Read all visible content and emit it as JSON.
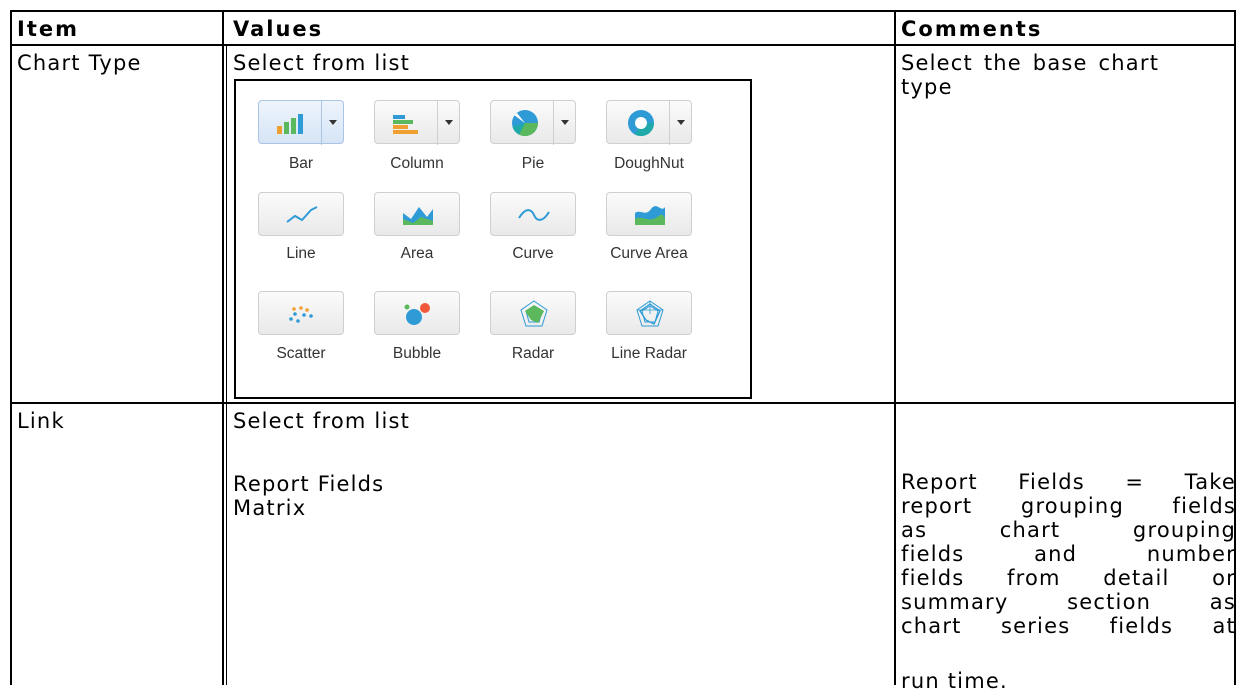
{
  "headers": {
    "item": "Item",
    "values": "Values",
    "comments": "Comments"
  },
  "rows": [
    {
      "item": "Chart Type",
      "value": "Select from list",
      "comment_line1": "Select the base chart",
      "comment_line2": "type"
    },
    {
      "item": "Link",
      "value": "Select from list",
      "options": [
        "Report Fields",
        "Matrix"
      ],
      "comment_lines": [
        "Report Fields = Take",
        "report grouping fields",
        "as chart grouping",
        "fields and number",
        "fields from detail or",
        "summary section as",
        "chart series fields at",
        "run time."
      ]
    }
  ],
  "chart_types": [
    {
      "label": "Bar",
      "icon": "bar-chart-icon",
      "dropdown": true,
      "selected": true
    },
    {
      "label": "Column",
      "icon": "column-chart-icon",
      "dropdown": true,
      "selected": false
    },
    {
      "label": "Pie",
      "icon": "pie-chart-icon",
      "dropdown": true,
      "selected": false
    },
    {
      "label": "DoughNut",
      "icon": "doughnut-chart-icon",
      "dropdown": true,
      "selected": false
    },
    {
      "label": "Line",
      "icon": "line-chart-icon",
      "dropdown": false,
      "selected": false
    },
    {
      "label": "Area",
      "icon": "area-chart-icon",
      "dropdown": false,
      "selected": false
    },
    {
      "label": "Curve",
      "icon": "curve-chart-icon",
      "dropdown": false,
      "selected": false
    },
    {
      "label": "Curve Area",
      "icon": "curve-area-chart-icon",
      "dropdown": false,
      "selected": false
    },
    {
      "label": "Scatter",
      "icon": "scatter-chart-icon",
      "dropdown": false,
      "selected": false
    },
    {
      "label": "Bubble",
      "icon": "bubble-chart-icon",
      "dropdown": false,
      "selected": false
    },
    {
      "label": "Radar",
      "icon": "radar-chart-icon",
      "dropdown": false,
      "selected": false
    },
    {
      "label": "Line Radar",
      "icon": "line-radar-chart-icon",
      "dropdown": false,
      "selected": false
    }
  ],
  "colors": {
    "blue": "#2e9bd6",
    "green": "#5cb85c",
    "orange": "#f0a030",
    "teal": "#1fa9a9"
  }
}
